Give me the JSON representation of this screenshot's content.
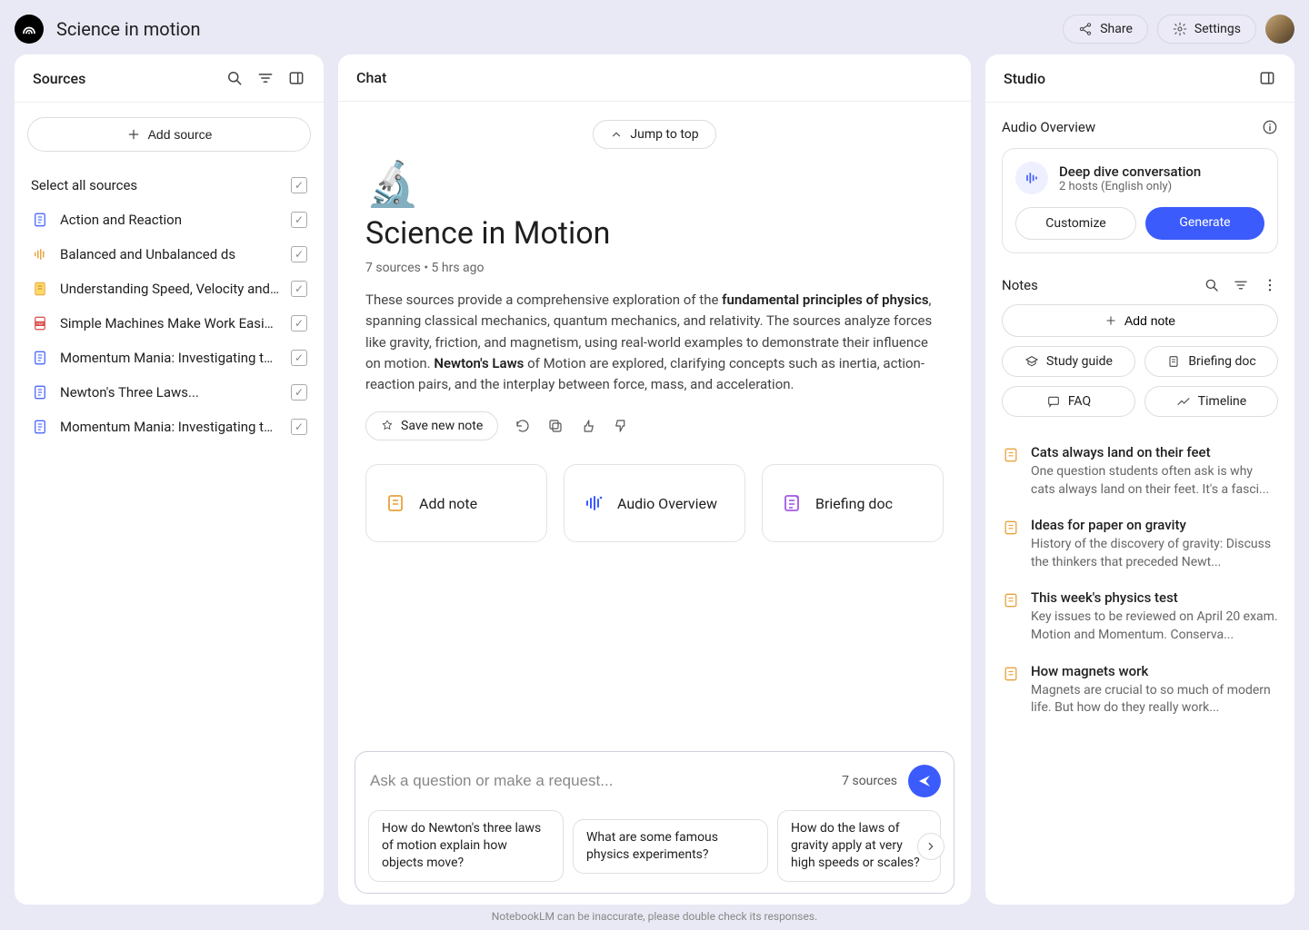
{
  "app": {
    "title": "Science in motion",
    "share": "Share",
    "settings": "Settings"
  },
  "sources": {
    "panel_title": "Sources",
    "add_label": "Add source",
    "select_all": "Select all sources",
    "items": [
      {
        "label": "Action and Reaction",
        "icon": "doc-blue"
      },
      {
        "label": "Balanced and Unbalanced ds",
        "icon": "audio"
      },
      {
        "label": "Understanding Speed, Velocity and...",
        "icon": "doc-yellow"
      },
      {
        "label": "Simple Machines Make Work Easier...",
        "icon": "pdf"
      },
      {
        "label": "Momentum Mania: Investigating th...",
        "icon": "doc-blue"
      },
      {
        "label": "Newton's Three Laws...",
        "icon": "doc-blue"
      },
      {
        "label": "Momentum Mania: Investigating th...",
        "icon": "doc-blue"
      }
    ]
  },
  "chat": {
    "panel_title": "Chat",
    "jump_top": "Jump to top",
    "emoji": "🔬",
    "title": "Science in Motion",
    "meta": "7 sources • 5 hrs ago",
    "desc_pre": "These sources provide a comprehensive exploration of the ",
    "desc_bold1": "fundamental principles of physics",
    "desc_mid": ", spanning classical mechanics, quantum mechanics, and relativity. The sources analyze forces like gravity, friction, and magnetism, using real-world examples to demonstrate their influence on motion. ",
    "desc_bold2": "Newton's Laws",
    "desc_post": " of Motion are explored, clarifying concepts such as inertia, action-reaction pairs, and the interplay between force, mass, and acceleration.",
    "save_note": "Save new note",
    "cards": {
      "add_note": "Add note",
      "audio": "Audio Overview",
      "briefing": "Briefing doc"
    },
    "input": {
      "placeholder": "Ask a question or make a request...",
      "src_count": "7 sources"
    },
    "prompts": [
      "How do Newton's three laws of motion explain how objects move?",
      "What are some famous physics experiments?",
      "How do the laws of gravity apply at very high speeds or scales?"
    ]
  },
  "studio": {
    "panel_title": "Studio",
    "audio_section": "Audio Overview",
    "audio_card": {
      "title": "Deep dive conversation",
      "sub": "2 hosts (English only)",
      "customize": "Customize",
      "generate": "Generate"
    },
    "notes_title": "Notes",
    "add_note": "Add note",
    "tools": {
      "study": "Study guide",
      "briefing": "Briefing doc",
      "faq": "FAQ",
      "timeline": "Timeline"
    },
    "notes": [
      {
        "title": "Cats always land on their feet",
        "snippet": "One question students often ask is why cats always land on their feet. It's a fasci..."
      },
      {
        "title": "Ideas for paper on gravity",
        "snippet": "History of the discovery of gravity: Discuss the thinkers that preceded Newt..."
      },
      {
        "title": "This week's physics test",
        "snippet": "Key issues to be reviewed on April 20 exam. Motion and Momentum. Conserva..."
      },
      {
        "title": "How magnets work",
        "snippet": "Magnets are crucial to so much of modern life. But how do they really work..."
      }
    ]
  },
  "footer": "NotebookLM can be inaccurate, please double check its responses."
}
